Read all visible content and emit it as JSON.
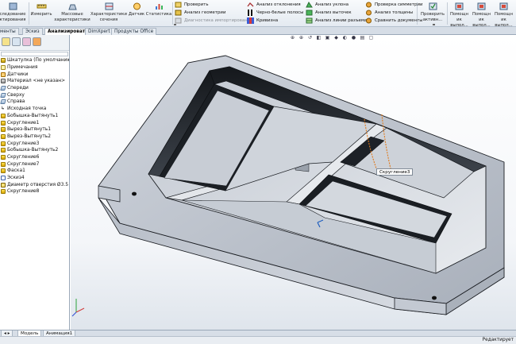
{
  "ribbon": {
    "left_cut_label": "следование\nктирования",
    "measure_label": "Измерить",
    "mass_label": "Массовые\nхарактеристики",
    "section_label": "Характеристики\nсечения",
    "sensor_label": "Датчик",
    "statistics_label": "Статистика",
    "col1": {
      "check": "Проверить",
      "geometry": "Анализ геометрии",
      "import": "Диагностика импортирования"
    },
    "col2": {
      "deviation": "Анализ отклонения",
      "zebra": "Черно-белые полосы",
      "curvature": "Кривизна"
    },
    "col3": {
      "draft": "Анализ уклона",
      "undercut": "Анализ выточек",
      "parting": "Анализ линии разъема"
    },
    "col4": {
      "symmetry": "Проверка симметрии",
      "thickness": "Анализ толщины",
      "compare": "Сравнить документы"
    },
    "check_active_label": "Проверить\nактивн...",
    "assist_labels": [
      "Помощн\nик\nвыпол...",
      "Помощн\nик\nвыпол...",
      "Помощн\nик\nвыпол..."
    ]
  },
  "tabs": [
    {
      "label": "менты",
      "active": false
    },
    {
      "label": "Эскиз",
      "active": false
    },
    {
      "label": "Анализировать",
      "active": true
    },
    {
      "label": "DimXpert",
      "active": false
    },
    {
      "label": "Продукты Office",
      "active": false
    }
  ],
  "tree": [
    {
      "label": "Шкатулка  (По умолчанию<<П",
      "icon": "part-icon"
    },
    {
      "label": "Примечания",
      "icon": "note-icon"
    },
    {
      "label": "Датчики",
      "icon": "sensor-icon"
    },
    {
      "label": "Материал <не указан>",
      "icon": "material-icon"
    },
    {
      "label": "Спереди",
      "icon": "plane-icon"
    },
    {
      "label": "Сверху",
      "icon": "plane-icon"
    },
    {
      "label": "Справа",
      "icon": "plane-icon"
    },
    {
      "label": "Исходная точка",
      "icon": "origin-icon"
    },
    {
      "label": "Бобышка-Вытянуть1",
      "icon": "feature-icon"
    },
    {
      "label": "Скругление1",
      "icon": "feature-icon"
    },
    {
      "label": "Вырез-Вытянуть1",
      "icon": "feature-icon"
    },
    {
      "label": "Вырез-Вытянуть2",
      "icon": "feature-icon"
    },
    {
      "label": "Скругление3",
      "icon": "feature-icon"
    },
    {
      "label": "Бобышка-Вытянуть2",
      "icon": "feature-icon"
    },
    {
      "label": "Скругление6",
      "icon": "feature-icon"
    },
    {
      "label": "Скругление7",
      "icon": "feature-icon"
    },
    {
      "label": "Фаска1",
      "icon": "feature-icon"
    },
    {
      "label": "Эскиз4",
      "icon": "sketch-icon"
    },
    {
      "label": "Диаметр отверстия Ø3.5 (3.5",
      "icon": "hole-icon"
    },
    {
      "label": "Скругление8",
      "icon": "feature-icon"
    }
  ],
  "viewport": {
    "tooltip": "Скругление3"
  },
  "bottom_tabs": [
    {
      "label": "Модель",
      "active": true
    },
    {
      "label": "Анимация1",
      "active": false
    }
  ],
  "status": {
    "right": "Редактирует"
  },
  "colors": {
    "accent": "#1f5fbf",
    "part_face": "#c3c9d3",
    "part_dark": "#111418"
  }
}
